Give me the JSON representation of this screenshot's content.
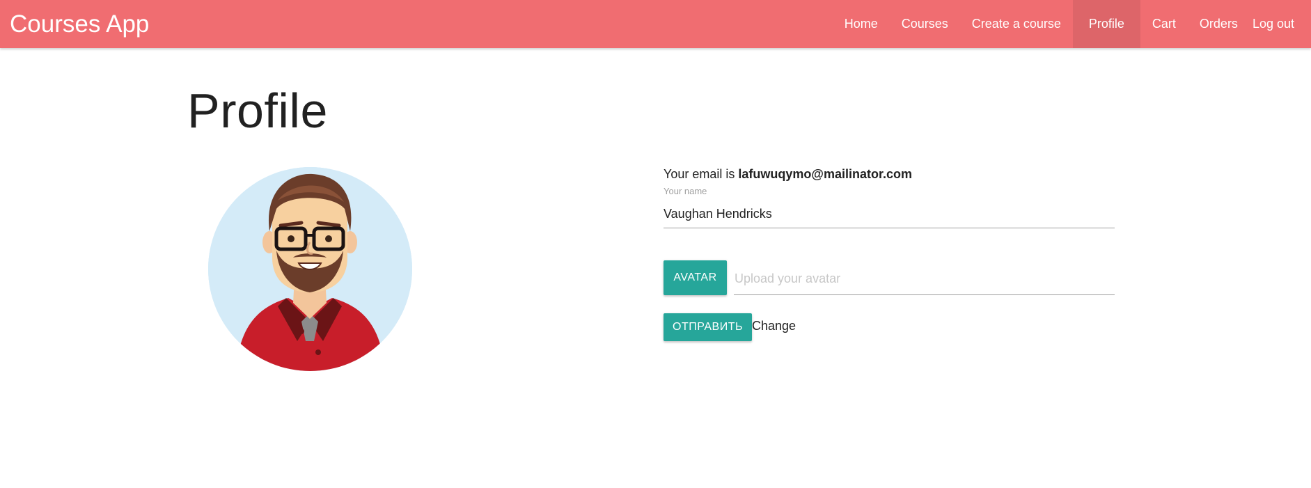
{
  "navbar": {
    "brand": "Courses App",
    "items": [
      {
        "label": "Home",
        "active": false
      },
      {
        "label": "Courses",
        "active": false
      },
      {
        "label": "Create a course",
        "active": false
      },
      {
        "label": "Profile",
        "active": true
      },
      {
        "label": "Cart",
        "active": false
      },
      {
        "label": "Orders",
        "active": false
      },
      {
        "label": "Log out",
        "active": false
      }
    ]
  },
  "page": {
    "title": "Profile"
  },
  "profile": {
    "avatar_icon": "avatar-illustration",
    "email_prefix": "Your email is",
    "email": "lafuwuqymo@mailinator.com",
    "name_label": "Your name",
    "name_value": "Vaughan Hendricks",
    "avatar_button": "Avatar",
    "avatar_placeholder": "Upload your avatar",
    "submit_button": "Отправить",
    "change_label": "Change"
  },
  "colors": {
    "navbar": "#f06d71",
    "navbar_active": "#dd6569",
    "button": "#26a69a",
    "avatar_bg": "#d4ebf8"
  }
}
